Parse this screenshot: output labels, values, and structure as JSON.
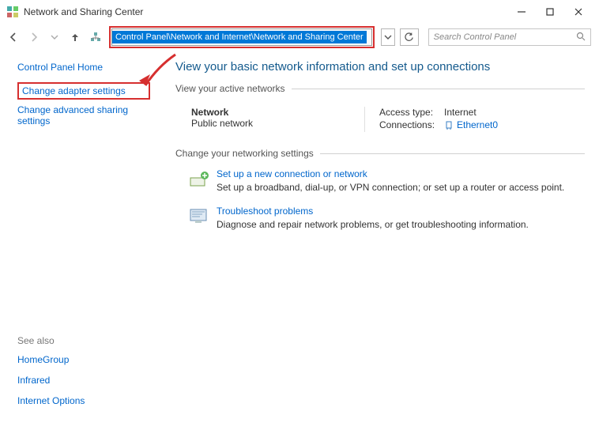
{
  "window": {
    "title": "Network and Sharing Center"
  },
  "nav": {
    "breadcrumb": "Control Panel\\Network and Internet\\Network and Sharing Center",
    "search_placeholder": "Search Control Panel"
  },
  "sidebar": {
    "home": "Control Panel Home",
    "adapter": "Change adapter settings",
    "advanced": "Change advanced sharing settings",
    "see_also_hdr": "See also",
    "see_also": {
      "homegroup": "HomeGroup",
      "infrared": "Infrared",
      "inet_opts": "Internet Options"
    }
  },
  "main": {
    "title": "View your basic network information and set up connections",
    "active_hdr": "View your active networks",
    "network": {
      "name": "Network",
      "type": "Public network",
      "access_label": "Access type:",
      "access_value": "Internet",
      "conn_label": "Connections:",
      "conn_value": "Ethernet0"
    },
    "settings_hdr": "Change your networking settings",
    "settings": {
      "setup_title": "Set up a new connection or network",
      "setup_desc": "Set up a broadband, dial-up, or VPN connection; or set up a router or access point.",
      "trouble_title": "Troubleshoot problems",
      "trouble_desc": "Diagnose and repair network problems, or get troubleshooting information."
    }
  }
}
